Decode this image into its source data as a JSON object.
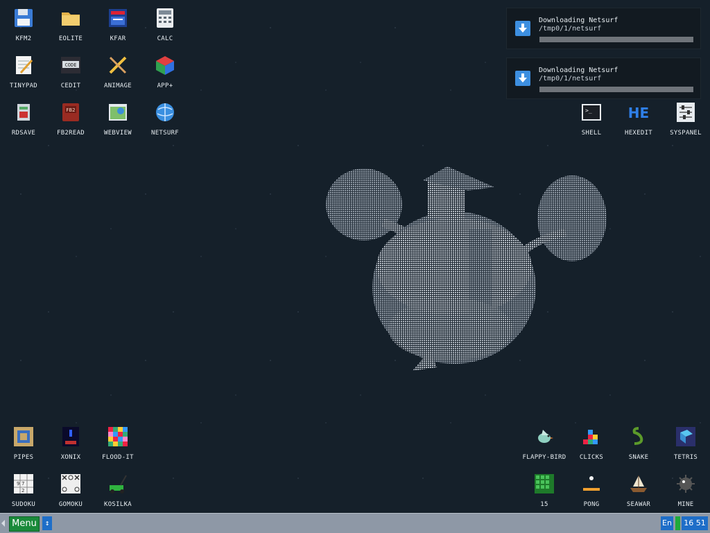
{
  "desktop": {
    "icons_top_left": [
      {
        "label": "KFM2",
        "icon": "floppy-disk-icon"
      },
      {
        "label": "EOLITE",
        "icon": "folder-icon"
      },
      {
        "label": "KFAR",
        "icon": "archive-icon"
      },
      {
        "label": "CALC",
        "icon": "calculator-icon"
      },
      {
        "label": "TINYPAD",
        "icon": "notepad-icon"
      },
      {
        "label": "CEDIT",
        "icon": "code-editor-icon"
      },
      {
        "label": "ANIMAGE",
        "icon": "paint-icon"
      },
      {
        "label": "APP+",
        "icon": "cube-icon"
      },
      {
        "label": "RDSAVE",
        "icon": "save-ram-icon"
      },
      {
        "label": "FB2READ",
        "icon": "book-icon"
      },
      {
        "label": "WEBVIEW",
        "icon": "web-view-icon"
      },
      {
        "label": "NETSURF",
        "icon": "globe-icon"
      }
    ],
    "icons_top_right": [
      {
        "label": "SHELL",
        "icon": "terminal-icon"
      },
      {
        "label": "HEXEDIT",
        "icon": "hex-editor-icon"
      },
      {
        "label": "SYSPANEL",
        "icon": "sliders-icon"
      }
    ],
    "icons_bottom_left": [
      {
        "label": "PIPES",
        "icon": "pipes-icon"
      },
      {
        "label": "XONIX",
        "icon": "xonix-icon"
      },
      {
        "label": "FLOOD-IT",
        "icon": "color-grid-icon"
      },
      {
        "label": "SUDOKU",
        "icon": "sudoku-icon"
      },
      {
        "label": "GOMOKU",
        "icon": "gomoku-icon"
      },
      {
        "label": "KOSILKA",
        "icon": "lawnmower-icon"
      }
    ],
    "icons_bottom_right": [
      {
        "label": "FLAPPY-BIRD",
        "icon": "bird-icon"
      },
      {
        "label": "CLICKS",
        "icon": "blocks-icon"
      },
      {
        "label": "SNAKE",
        "icon": "snake-icon"
      },
      {
        "label": "TETRIS",
        "icon": "tetris-icon"
      },
      {
        "label": "15",
        "icon": "fifteen-puzzle-icon"
      },
      {
        "label": "PONG",
        "icon": "pong-icon"
      },
      {
        "label": "SEAWAR",
        "icon": "ship-icon"
      },
      {
        "label": "MINE",
        "icon": "mine-icon"
      }
    ]
  },
  "notifications": [
    {
      "title": "Downloading Netsurf",
      "path": "/tmp0/1/netsurf",
      "progress": 0
    },
    {
      "title": "Downloading Netsurf",
      "path": "/tmp0/1/netsurf",
      "progress": 0
    }
  ],
  "taskbar": {
    "menu_label": "Menu",
    "scroll_glyph": "↕",
    "language": "En",
    "clock": "16 51"
  },
  "colors": {
    "desktop_bg": "#15202a",
    "taskbar_bg": "#8e98a6",
    "menu_green": "#1a8a3a",
    "accent_blue": "#1e6ec8"
  }
}
